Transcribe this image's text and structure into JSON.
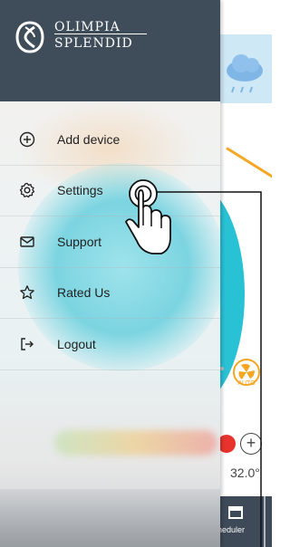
{
  "brand": {
    "line1": "OLIMPIA",
    "line2": "SPLENDID"
  },
  "menu": {
    "items": [
      {
        "label": "Add device",
        "icon": "plus-circle-icon"
      },
      {
        "label": "Settings",
        "icon": "gear-icon"
      },
      {
        "label": "Support",
        "icon": "mail-icon"
      },
      {
        "label": "Rated Us",
        "icon": "star-icon"
      },
      {
        "label": "Logout",
        "icon": "logout-icon"
      }
    ]
  },
  "background": {
    "temperature": "32.0°",
    "fan_mode": "AUTO",
    "scheduler_label": "heduler"
  },
  "colors": {
    "header": "#3f4c5a",
    "accent_teal": "#29c1d4",
    "accent_orange": "#f5a623",
    "accent_red": "#e8332d"
  }
}
